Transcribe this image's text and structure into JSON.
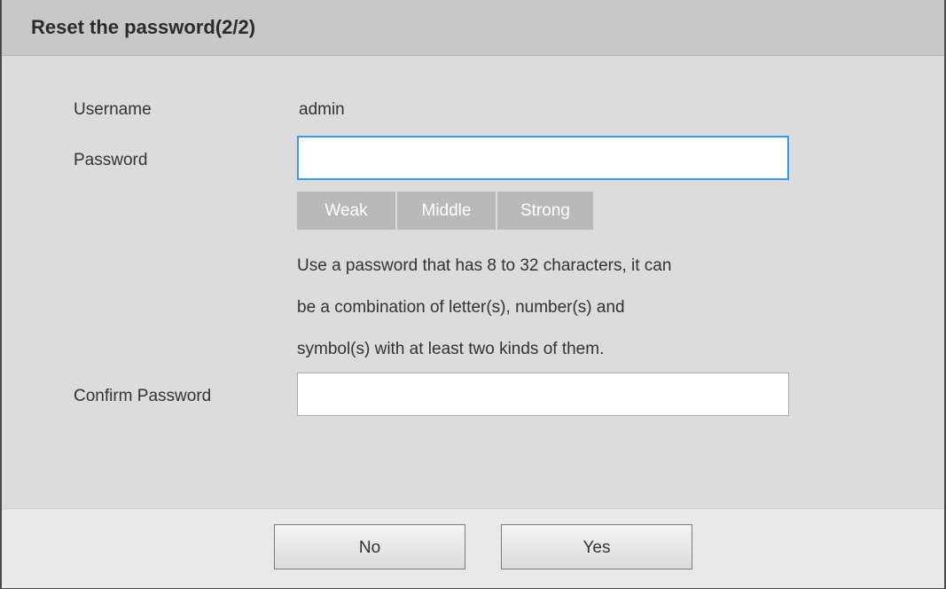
{
  "dialog": {
    "title": "Reset the password(2/2)"
  },
  "form": {
    "username_label": "Username",
    "username_value": "admin",
    "password_label": "Password",
    "password_value": "",
    "strength": [
      "Weak",
      "Middle",
      "Strong"
    ],
    "hint_lines": [
      "Use a password that has 8 to 32 characters, it can",
      "be a combination of letter(s), number(s) and",
      "symbol(s) with at least two kinds of them."
    ],
    "confirm_label": "Confirm Password",
    "confirm_value": ""
  },
  "footer": {
    "no_label": "No",
    "yes_label": "Yes"
  },
  "colors": {
    "focus_border": "#3b9ae8",
    "strength_bg": "#b9b9b9",
    "titlebar_bg": "#c8c8c8"
  }
}
